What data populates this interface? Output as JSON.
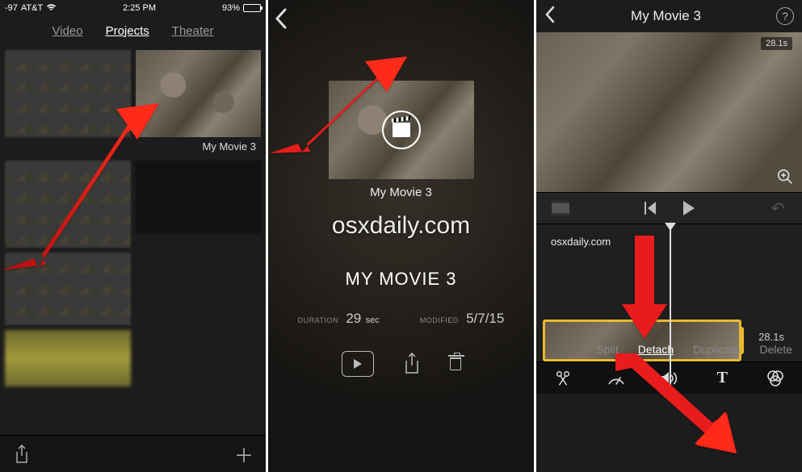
{
  "screen1": {
    "status": {
      "signal_text": "-97",
      "carrier": "AT&T",
      "wifi_icon": "wifi-icon",
      "time": "2:25 PM",
      "battery_pct": "93%"
    },
    "tabs": {
      "video": "Video",
      "projects": "Projects",
      "theater": "Theater"
    },
    "project_label": "My Movie 3",
    "bottom": {
      "share": "share-icon",
      "add": "plus-icon"
    }
  },
  "screen2": {
    "back": "back-icon",
    "project_label": "My Movie 3",
    "watermark": "osxdaily.com",
    "title": "MY MOVIE 3",
    "meta": {
      "duration_k": "DURATION",
      "duration_v": "29",
      "duration_u": "sec",
      "modified_k": "MODIFIED",
      "modified_v": "5/7/15"
    },
    "actions": {
      "play": "play-icon",
      "share": "share-icon",
      "delete": "trash-icon"
    }
  },
  "screen3": {
    "header": {
      "back": "back-icon",
      "title": "My Movie 3",
      "help": "?"
    },
    "preview_duration": "28.1s",
    "timeline_text": "osxdaily.com",
    "clip_duration": "28.1s",
    "edit_actions": {
      "split": "Split",
      "detach": "Detach",
      "duplicate": "Duplicate",
      "delete": "Delete"
    },
    "toolbar": {
      "cut": "scissors-icon",
      "speed": "speedometer-icon",
      "volume": "volume-icon",
      "text": "T",
      "filter": "filters-icon"
    }
  }
}
